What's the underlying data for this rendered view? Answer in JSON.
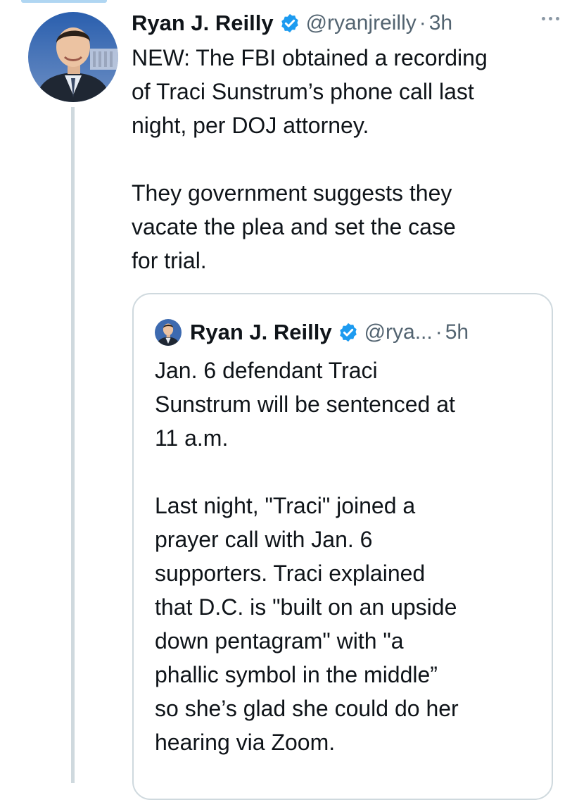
{
  "main_tweet": {
    "author": {
      "display_name": "Ryan J. Reilly",
      "handle": "@ryanjreilly",
      "verified": true
    },
    "separator": "·",
    "time": "3h",
    "more_icon": "more-horizontal-icon",
    "text_lines": [
      [
        "NEW: The FBI obtained a recording",
        "of Traci Sunstrum’s phone call last",
        "night, per DOJ attorney."
      ],
      [
        "They government suggests they",
        "vacate the plea and set the case",
        "for trial."
      ]
    ]
  },
  "quoted_tweet": {
    "author": {
      "display_name": "Ryan J. Reilly",
      "handle": "@rya...",
      "verified": true
    },
    "separator": "·",
    "time": "5h",
    "text_lines": [
      [
        "Jan. 6 defendant Traci",
        "Sunstrum will be sentenced at",
        "11 a.m."
      ],
      [
        "Last night, \"Traci\" joined a",
        "prayer call with Jan. 6",
        "supporters. Traci explained",
        "that D.C. is \"built on an upside",
        "down pentagram\" with \"a",
        "phallic symbol in the middle”",
        "so she’s glad she could do her",
        "hearing via Zoom."
      ]
    ]
  },
  "colors": {
    "text": "#0f1419",
    "secondary": "#536471",
    "verified_blue": "#1d9bf0",
    "border": "#cfd9de"
  }
}
